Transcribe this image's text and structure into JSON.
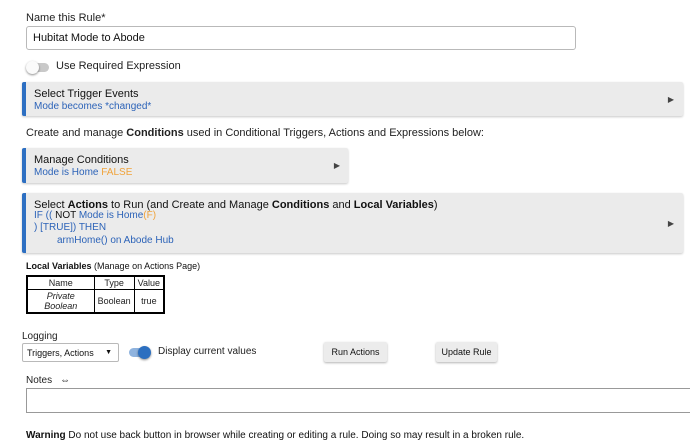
{
  "name_rule": {
    "label": "Name this Rule*",
    "value": "Hubitat Mode to Abode"
  },
  "required_expression": {
    "label": "Use Required Expression"
  },
  "trigger_panel": {
    "title": "Select Trigger Events",
    "summary": "Mode becomes *changed*"
  },
  "conditions_intro": {
    "pre": "Create and manage ",
    "bold": "Conditions",
    "post": " used in Conditional Triggers, Actions and Expressions below:"
  },
  "manage_conditions": {
    "title": "Manage Conditions",
    "summary_blue": "Mode is Home ",
    "summary_orange": "FALSE"
  },
  "actions_panel": {
    "title_pre": "Select ",
    "title_bold1": "Actions",
    "title_mid": " to Run (and Create and Manage ",
    "title_bold2": "Conditions",
    "title_and": " and ",
    "title_bold3": "Local Variables",
    "title_end": ")",
    "line1_a": "IF (( ",
    "line1_not": "NOT",
    "line1_b": " Mode is Home",
    "line1_f": "(F)",
    "line2": ") [TRUE]) THEN",
    "line3": "armHome() on Abode Hub"
  },
  "local_vars": {
    "heading_bold": "Local Variables",
    "heading_rest": " (Manage on Actions Page)",
    "columns": [
      "Name",
      "Type",
      "Value"
    ],
    "rows": [
      {
        "name": "Private Boolean",
        "type": "Boolean",
        "value": "true"
      }
    ]
  },
  "logging": {
    "label": "Logging",
    "selected": "Triggers, Actions"
  },
  "display_values": {
    "label": "Display current values"
  },
  "buttons": {
    "run_actions": "Run Actions",
    "update_rule": "Update Rule"
  },
  "notes": {
    "label": "Notes",
    "icon_glyph": "⇔"
  },
  "warning": {
    "bold": "Warning",
    "text": " Do not use back button in browser while creating or editing a rule. Doing so may result in a broken rule."
  },
  "colors": {
    "accent": "#2d6fc2",
    "link": "#2c63b8",
    "false_value": "#f0a33b",
    "panel_bg": "#ebebeb"
  }
}
